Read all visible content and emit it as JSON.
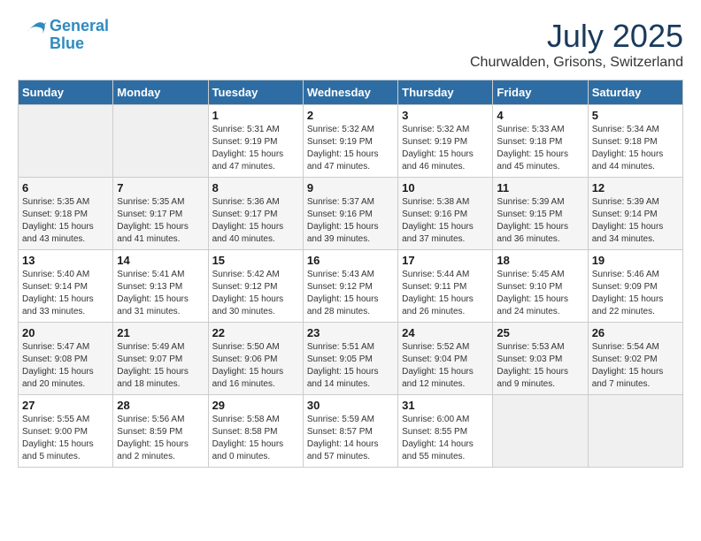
{
  "header": {
    "logo_line1": "General",
    "logo_line2": "Blue",
    "month_year": "July 2025",
    "location": "Churwalden, Grisons, Switzerland"
  },
  "weekdays": [
    "Sunday",
    "Monday",
    "Tuesday",
    "Wednesday",
    "Thursday",
    "Friday",
    "Saturday"
  ],
  "weeks": [
    [
      {
        "day": "",
        "sunrise": "",
        "sunset": "",
        "daylight": ""
      },
      {
        "day": "",
        "sunrise": "",
        "sunset": "",
        "daylight": ""
      },
      {
        "day": "1",
        "sunrise": "Sunrise: 5:31 AM",
        "sunset": "Sunset: 9:19 PM",
        "daylight": "Daylight: 15 hours and 47 minutes."
      },
      {
        "day": "2",
        "sunrise": "Sunrise: 5:32 AM",
        "sunset": "Sunset: 9:19 PM",
        "daylight": "Daylight: 15 hours and 47 minutes."
      },
      {
        "day": "3",
        "sunrise": "Sunrise: 5:32 AM",
        "sunset": "Sunset: 9:19 PM",
        "daylight": "Daylight: 15 hours and 46 minutes."
      },
      {
        "day": "4",
        "sunrise": "Sunrise: 5:33 AM",
        "sunset": "Sunset: 9:18 PM",
        "daylight": "Daylight: 15 hours and 45 minutes."
      },
      {
        "day": "5",
        "sunrise": "Sunrise: 5:34 AM",
        "sunset": "Sunset: 9:18 PM",
        "daylight": "Daylight: 15 hours and 44 minutes."
      }
    ],
    [
      {
        "day": "6",
        "sunrise": "Sunrise: 5:35 AM",
        "sunset": "Sunset: 9:18 PM",
        "daylight": "Daylight: 15 hours and 43 minutes."
      },
      {
        "day": "7",
        "sunrise": "Sunrise: 5:35 AM",
        "sunset": "Sunset: 9:17 PM",
        "daylight": "Daylight: 15 hours and 41 minutes."
      },
      {
        "day": "8",
        "sunrise": "Sunrise: 5:36 AM",
        "sunset": "Sunset: 9:17 PM",
        "daylight": "Daylight: 15 hours and 40 minutes."
      },
      {
        "day": "9",
        "sunrise": "Sunrise: 5:37 AM",
        "sunset": "Sunset: 9:16 PM",
        "daylight": "Daylight: 15 hours and 39 minutes."
      },
      {
        "day": "10",
        "sunrise": "Sunrise: 5:38 AM",
        "sunset": "Sunset: 9:16 PM",
        "daylight": "Daylight: 15 hours and 37 minutes."
      },
      {
        "day": "11",
        "sunrise": "Sunrise: 5:39 AM",
        "sunset": "Sunset: 9:15 PM",
        "daylight": "Daylight: 15 hours and 36 minutes."
      },
      {
        "day": "12",
        "sunrise": "Sunrise: 5:39 AM",
        "sunset": "Sunset: 9:14 PM",
        "daylight": "Daylight: 15 hours and 34 minutes."
      }
    ],
    [
      {
        "day": "13",
        "sunrise": "Sunrise: 5:40 AM",
        "sunset": "Sunset: 9:14 PM",
        "daylight": "Daylight: 15 hours and 33 minutes."
      },
      {
        "day": "14",
        "sunrise": "Sunrise: 5:41 AM",
        "sunset": "Sunset: 9:13 PM",
        "daylight": "Daylight: 15 hours and 31 minutes."
      },
      {
        "day": "15",
        "sunrise": "Sunrise: 5:42 AM",
        "sunset": "Sunset: 9:12 PM",
        "daylight": "Daylight: 15 hours and 30 minutes."
      },
      {
        "day": "16",
        "sunrise": "Sunrise: 5:43 AM",
        "sunset": "Sunset: 9:12 PM",
        "daylight": "Daylight: 15 hours and 28 minutes."
      },
      {
        "day": "17",
        "sunrise": "Sunrise: 5:44 AM",
        "sunset": "Sunset: 9:11 PM",
        "daylight": "Daylight: 15 hours and 26 minutes."
      },
      {
        "day": "18",
        "sunrise": "Sunrise: 5:45 AM",
        "sunset": "Sunset: 9:10 PM",
        "daylight": "Daylight: 15 hours and 24 minutes."
      },
      {
        "day": "19",
        "sunrise": "Sunrise: 5:46 AM",
        "sunset": "Sunset: 9:09 PM",
        "daylight": "Daylight: 15 hours and 22 minutes."
      }
    ],
    [
      {
        "day": "20",
        "sunrise": "Sunrise: 5:47 AM",
        "sunset": "Sunset: 9:08 PM",
        "daylight": "Daylight: 15 hours and 20 minutes."
      },
      {
        "day": "21",
        "sunrise": "Sunrise: 5:49 AM",
        "sunset": "Sunset: 9:07 PM",
        "daylight": "Daylight: 15 hours and 18 minutes."
      },
      {
        "day": "22",
        "sunrise": "Sunrise: 5:50 AM",
        "sunset": "Sunset: 9:06 PM",
        "daylight": "Daylight: 15 hours and 16 minutes."
      },
      {
        "day": "23",
        "sunrise": "Sunrise: 5:51 AM",
        "sunset": "Sunset: 9:05 PM",
        "daylight": "Daylight: 15 hours and 14 minutes."
      },
      {
        "day": "24",
        "sunrise": "Sunrise: 5:52 AM",
        "sunset": "Sunset: 9:04 PM",
        "daylight": "Daylight: 15 hours and 12 minutes."
      },
      {
        "day": "25",
        "sunrise": "Sunrise: 5:53 AM",
        "sunset": "Sunset: 9:03 PM",
        "daylight": "Daylight: 15 hours and 9 minutes."
      },
      {
        "day": "26",
        "sunrise": "Sunrise: 5:54 AM",
        "sunset": "Sunset: 9:02 PM",
        "daylight": "Daylight: 15 hours and 7 minutes."
      }
    ],
    [
      {
        "day": "27",
        "sunrise": "Sunrise: 5:55 AM",
        "sunset": "Sunset: 9:00 PM",
        "daylight": "Daylight: 15 hours and 5 minutes."
      },
      {
        "day": "28",
        "sunrise": "Sunrise: 5:56 AM",
        "sunset": "Sunset: 8:59 PM",
        "daylight": "Daylight: 15 hours and 2 minutes."
      },
      {
        "day": "29",
        "sunrise": "Sunrise: 5:58 AM",
        "sunset": "Sunset: 8:58 PM",
        "daylight": "Daylight: 15 hours and 0 minutes."
      },
      {
        "day": "30",
        "sunrise": "Sunrise: 5:59 AM",
        "sunset": "Sunset: 8:57 PM",
        "daylight": "Daylight: 14 hours and 57 minutes."
      },
      {
        "day": "31",
        "sunrise": "Sunrise: 6:00 AM",
        "sunset": "Sunset: 8:55 PM",
        "daylight": "Daylight: 14 hours and 55 minutes."
      },
      {
        "day": "",
        "sunrise": "",
        "sunset": "",
        "daylight": ""
      },
      {
        "day": "",
        "sunrise": "",
        "sunset": "",
        "daylight": ""
      }
    ]
  ]
}
